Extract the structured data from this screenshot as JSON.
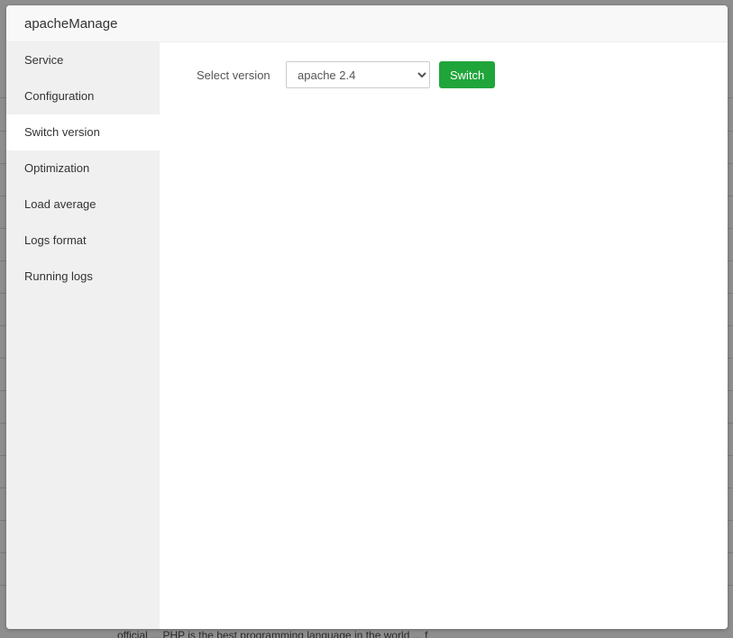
{
  "modal": {
    "title": "apacheManage"
  },
  "sidebar": {
    "items": [
      {
        "label": "Service",
        "active": false
      },
      {
        "label": "Configuration",
        "active": false
      },
      {
        "label": "Switch version",
        "active": true
      },
      {
        "label": "Optimization",
        "active": false
      },
      {
        "label": "Load average",
        "active": false
      },
      {
        "label": "Logs format",
        "active": false
      },
      {
        "label": "Running logs",
        "active": false
      }
    ]
  },
  "switch_version": {
    "label": "Select version",
    "selected": "apache 2.4",
    "button_label": "Switch"
  },
  "backdrop": {
    "partial_text": "official ... PHP is the best programming language in the world ... f"
  },
  "colors": {
    "accent": "#20a53a",
    "sidebar_bg": "#f0f0f0",
    "overlay": "#8e8e8e"
  }
}
